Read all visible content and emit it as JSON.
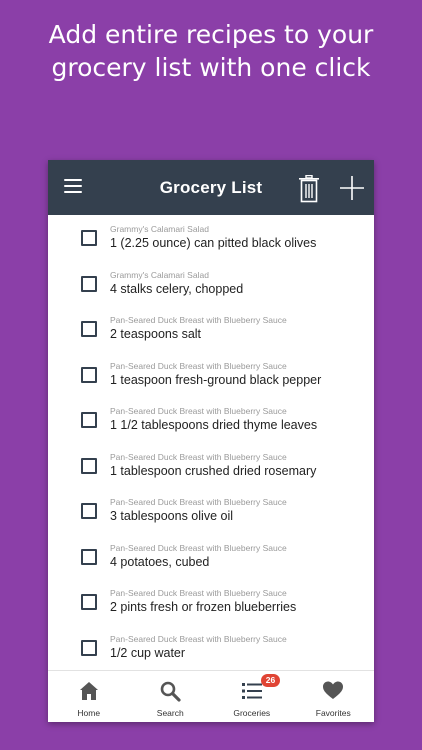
{
  "promo": {
    "line1": "Add entire recipes to your",
    "line2": "grocery list with one click"
  },
  "appbar": {
    "title": "Grocery List"
  },
  "items": [
    {
      "source": "Grammy's Calamari Salad",
      "name": "1 (2.25 ounce) can pitted black olives",
      "checked": false
    },
    {
      "source": "Grammy's Calamari Salad",
      "name": "4 stalks celery, chopped",
      "checked": false
    },
    {
      "source": "Pan-Seared Duck Breast with Blueberry Sauce",
      "name": "2 teaspoons salt",
      "checked": false
    },
    {
      "source": "Pan-Seared Duck Breast with Blueberry Sauce",
      "name": "1 teaspoon fresh-ground black pepper",
      "checked": false
    },
    {
      "source": "Pan-Seared Duck Breast with Blueberry Sauce",
      "name": "1 1/2 tablespoons dried thyme leaves",
      "checked": false
    },
    {
      "source": "Pan-Seared Duck Breast with Blueberry Sauce",
      "name": "1 tablespoon crushed dried rosemary",
      "checked": false
    },
    {
      "source": "Pan-Seared Duck Breast with Blueberry Sauce",
      "name": "3 tablespoons olive oil",
      "checked": false
    },
    {
      "source": "Pan-Seared Duck Breast with Blueberry Sauce",
      "name": "4 potatoes, cubed",
      "checked": false
    },
    {
      "source": "Pan-Seared Duck Breast with Blueberry Sauce",
      "name": "2 pints fresh or frozen blueberries",
      "checked": false
    },
    {
      "source": "Pan-Seared Duck Breast with Blueberry Sauce",
      "name": "1/2 cup water",
      "checked": false
    }
  ],
  "tabs": [
    {
      "label": "Home",
      "icon": "home-icon"
    },
    {
      "label": "Search",
      "icon": "search-icon"
    },
    {
      "label": "Groceries",
      "icon": "list-icon",
      "badge": "26"
    },
    {
      "label": "Favorites",
      "icon": "heart-icon"
    }
  ],
  "colors": {
    "background": "#8b3fa8",
    "appbar": "#34404e",
    "badge": "#e04434"
  }
}
